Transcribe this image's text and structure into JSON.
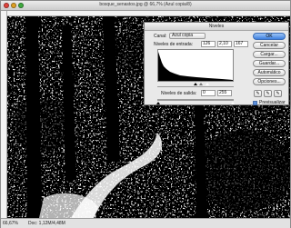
{
  "document": {
    "title": "bosque_senastos.jpg @ 66,7% (Azul copia/8)",
    "zoom": "66,67%",
    "info": "Doc: 1,12M/4,48M"
  },
  "levels_dialog": {
    "title": "Niveles",
    "channel_label": "Canal:",
    "channel_value": "Azul copia",
    "input_levels_label": "Niveles de entrada:",
    "input_black": "126",
    "input_gamma": "2,10",
    "input_white": "167",
    "output_levels_label": "Niveles de salida:",
    "output_black": "0",
    "output_white": "255",
    "buttons": {
      "ok": "OK",
      "cancel": "Cancelar",
      "load": "Cargar...",
      "save": "Guardar...",
      "auto": "Automático",
      "options": "Opciones..."
    },
    "preview_label": "Previsualizar",
    "preview_checked": true
  },
  "colors": {
    "accent": "#3d80e0"
  }
}
